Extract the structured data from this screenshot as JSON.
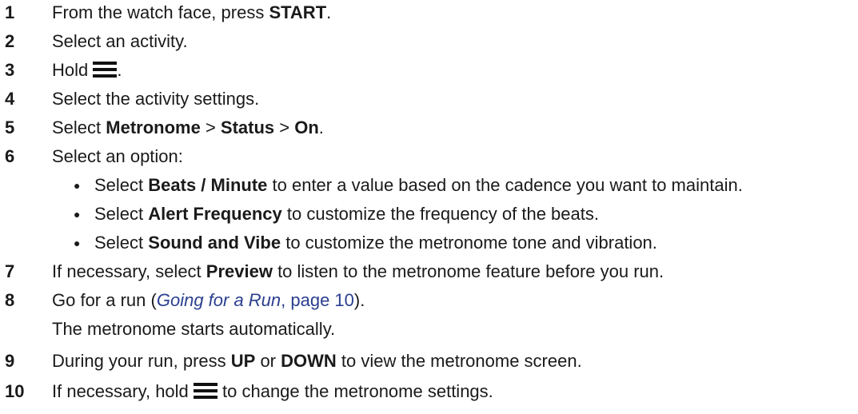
{
  "steps": [
    {
      "num": "1",
      "pre": "From the watch face, press ",
      "b1": "START",
      "post": "."
    },
    {
      "num": "2",
      "text": "Select an activity."
    },
    {
      "num": "3",
      "pre": "Hold ",
      "post": ".",
      "icon": "menu-icon"
    },
    {
      "num": "4",
      "text": "Select the activity settings."
    },
    {
      "num": "5",
      "pre": "Select ",
      "b1": "Metronome",
      "s1": " > ",
      "b2": "Status",
      "s2": " > ",
      "b3": "On",
      "post": "."
    },
    {
      "num": "6",
      "text": "Select an option:",
      "options": [
        {
          "pre": "Select ",
          "bold": "Beats / Minute",
          "post": " to enter a value based on the cadence you want to maintain."
        },
        {
          "pre": "Select ",
          "bold": "Alert Frequency",
          "post": " to customize the frequency of the beats."
        },
        {
          "pre": "Select ",
          "bold": "Sound and Vibe",
          "post": " to customize the metronome tone and vibration."
        }
      ]
    },
    {
      "num": "7",
      "pre": "If necessary, select ",
      "b1": "Preview",
      "post": " to listen to the metronome feature before you run."
    },
    {
      "num": "8",
      "pre": "Go for a run (",
      "link_title": "Going for a Run",
      "link_page": ", page 10",
      "post": ").",
      "continuation": "The metronome starts automatically."
    },
    {
      "num": "9",
      "pre": "During your run, press ",
      "b1": "UP",
      "s1": " or ",
      "b2": "DOWN",
      "post": " to view the metronome screen."
    },
    {
      "num": "10",
      "pre": "If necessary, hold ",
      "post": " to change the metronome settings.",
      "icon": "menu-icon"
    }
  ]
}
